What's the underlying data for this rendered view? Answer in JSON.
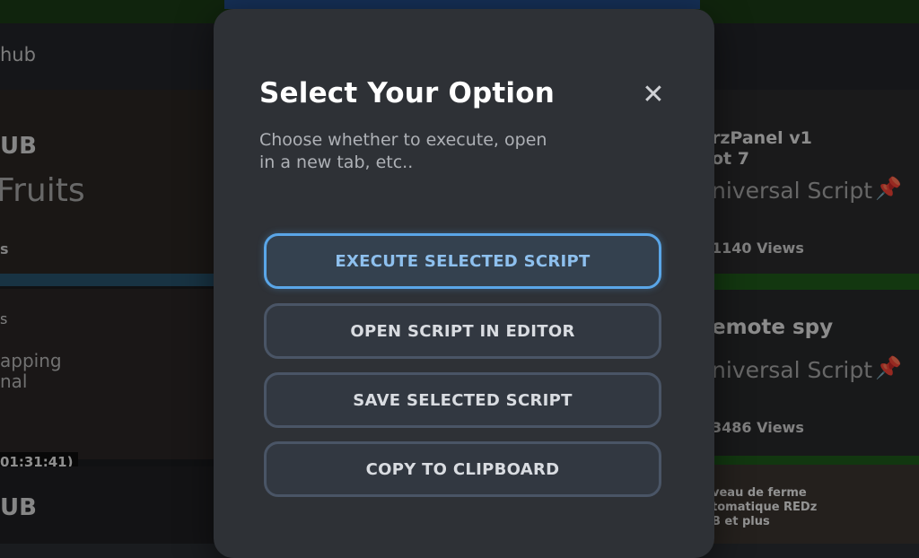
{
  "background": {
    "hub_label": "hub",
    "left_cards": {
      "card1_title": "UB",
      "card1_game": "Fruits",
      "card1_stat": "s",
      "card2_mark": "s",
      "card2_line1": "apping",
      "card2_line2": "nal",
      "timestamp": "01:31:41)",
      "card3_title": "UB"
    },
    "right_cards": {
      "card1_title_line1": "rzPanel v1",
      "card1_title_line2": "ot 7",
      "card1_subtitle": "niversal Script",
      "card1_views": "1140 Views",
      "card2_title": "emote spy",
      "card2_subtitle": "niversal Script",
      "card2_views": "3486 Views",
      "card3_line1": "veau de ferme",
      "card3_line2": "tomatique REDz",
      "card3_line3": "B et plus"
    },
    "pin_icon": "pushpin-icon"
  },
  "modal": {
    "title": "Select Your Option",
    "description": "Choose whether to execute, open in a new tab, etc..",
    "close_icon": "close-icon",
    "close_glyph": "✕",
    "options": [
      {
        "label": "EXECUTE SELECTED SCRIPT",
        "selected": true
      },
      {
        "label": "OPEN SCRIPT IN EDITOR",
        "selected": false
      },
      {
        "label": "SAVE SELECTED SCRIPT",
        "selected": false
      },
      {
        "label": "COPY TO CLIPBOARD",
        "selected": false
      }
    ],
    "accent_color": "#5aa6e8"
  }
}
